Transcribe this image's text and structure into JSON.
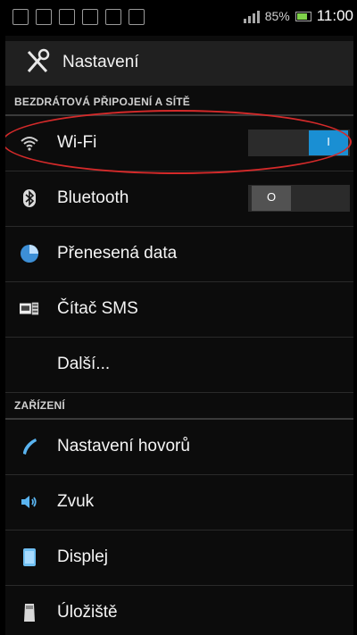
{
  "status_bar": {
    "battery_percent": "85%",
    "time": "11:00",
    "icons": [
      "image-icon",
      "mail-icon",
      "email-icon",
      "missed-call-icon",
      "unknown-sim-icon",
      "alarm-icon"
    ]
  },
  "action_bar": {
    "title": "Nastavení",
    "icon": "settings-tools-icon"
  },
  "sections": {
    "wireless": "BEZDRÁTOVÁ PŘIPOJENÍ A SÍTĚ",
    "device": "ZAŘÍZENÍ"
  },
  "items": {
    "wifi": {
      "label": "Wi-Fi",
      "icon": "wifi-icon",
      "toggle_on": true,
      "toggle_text": "I"
    },
    "bluetooth": {
      "label": "Bluetooth",
      "icon": "bluetooth-icon",
      "toggle_on": false,
      "toggle_text": "O"
    },
    "data_usage": {
      "label": "Přenesená data",
      "icon": "data-usage-icon"
    },
    "sms_counter": {
      "label": "Čítač SMS",
      "icon": "sms-counter-icon"
    },
    "more": {
      "label": "Další..."
    },
    "call_settings": {
      "label": "Nastavení hovorů",
      "icon": "phone-icon"
    },
    "sound": {
      "label": "Zvuk",
      "icon": "speaker-icon"
    },
    "display": {
      "label": "Displej",
      "icon": "display-icon"
    },
    "storage": {
      "label": "Úložiště",
      "icon": "storage-icon"
    }
  },
  "colors": {
    "accent": "#1a8fd3",
    "highlight_circle": "#d42a2a",
    "background": "#0c0c0c"
  }
}
